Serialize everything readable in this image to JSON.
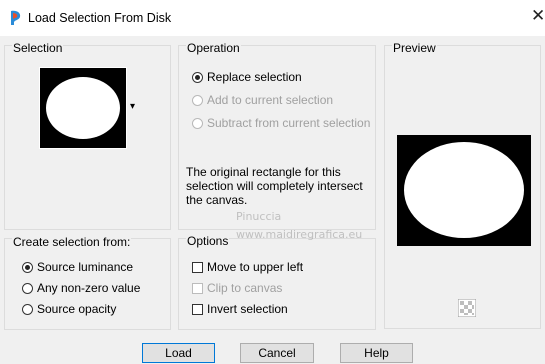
{
  "window": {
    "title": "Load Selection From Disk",
    "close_glyph": "✕",
    "app_icon": "paintbrush-app-icon"
  },
  "selection": {
    "legend": "Selection",
    "dropdown_glyph": "▾"
  },
  "operation": {
    "legend": "Operation",
    "options": [
      {
        "label": "Replace selection",
        "checked": true,
        "enabled": true
      },
      {
        "label": "Add to current selection",
        "checked": false,
        "enabled": false
      },
      {
        "label": "Subtract from current selection",
        "checked": false,
        "enabled": false
      }
    ],
    "info": "The original rectangle for this selection will completely intersect the canvas."
  },
  "preview": {
    "legend": "Preview",
    "checker_icon": "transparency-toggle-icon"
  },
  "create_from": {
    "legend": "Create selection from:",
    "options": [
      {
        "label": "Source luminance",
        "checked": true
      },
      {
        "label": "Any non-zero value",
        "checked": false
      },
      {
        "label": "Source opacity",
        "checked": false
      }
    ]
  },
  "options": {
    "legend": "Options",
    "items": [
      {
        "label": "Move to upper left",
        "checked": false,
        "enabled": true
      },
      {
        "label": "Clip to canvas",
        "checked": false,
        "enabled": false
      },
      {
        "label": "Invert selection",
        "checked": false,
        "enabled": true
      }
    ]
  },
  "buttons": {
    "load": "Load",
    "cancel": "Cancel",
    "help": "Help"
  },
  "watermark": {
    "line1": "Pinuccia",
    "line2": "www.maidiregrafica.eu"
  },
  "colors": {
    "accent": "#0078d7",
    "panel_border": "#dcdcdc",
    "background": "#f0f0f0"
  }
}
